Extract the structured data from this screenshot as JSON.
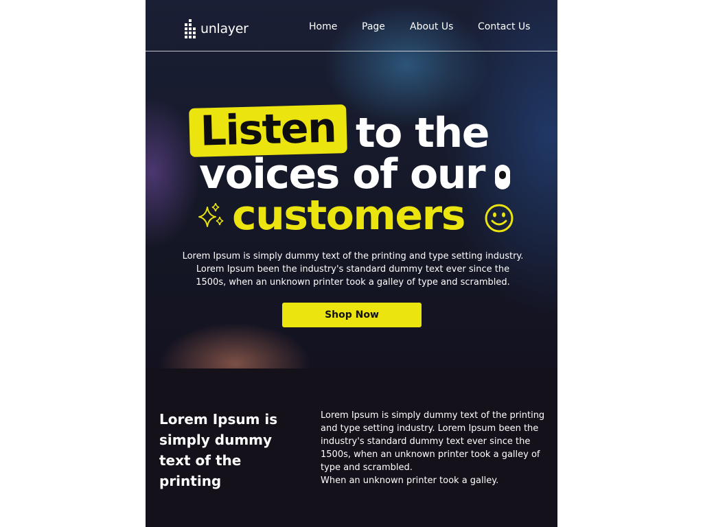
{
  "brand": {
    "logo_text": "unlayer"
  },
  "nav": {
    "items": [
      "Home",
      "Page",
      "About Us",
      "Contact Us"
    ]
  },
  "hero": {
    "line1_highlight": "Listen",
    "line1_rest": "to the",
    "line2": "voices of our",
    "line3": "customers",
    "description": "Lorem Ipsum is simply dummy text of the printing and type setting industry. Lorem Ipsum been the industry's standard dummy text ever since the 1500s, when an unknown printer took a galley of type and scrambled.",
    "cta_label": "Shop Now"
  },
  "section2": {
    "title": "Lorem Ipsum is simply dummy text of the printing",
    "body": "Lorem Ipsum is simply dummy text of the printing and type setting industry. Lorem Ipsum been the industry's standard dummy text ever since the 1500s, when an unknown printer took a galley of type and scrambled.",
    "body_extra": "When an unknown printer took a galley."
  },
  "icons": [
    "logo-icon",
    "sparkles-icon",
    "smiley-icon",
    "toggle-pill-icon"
  ],
  "colors": {
    "accent": "#ece40f",
    "background": "#14111a",
    "text": "#ffffff"
  }
}
